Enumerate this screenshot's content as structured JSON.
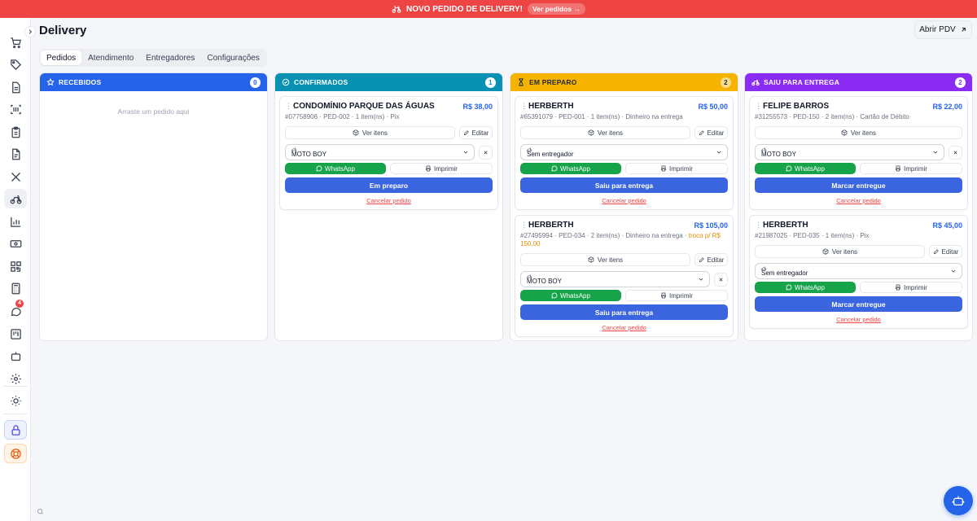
{
  "banner": {
    "text": "NOVO PEDIDO DE DELIVERY!",
    "link": "Ver pedidos →"
  },
  "page": {
    "title": "Delivery",
    "open_pos": "Abrir PDV"
  },
  "tabs": [
    "Pedidos",
    "Atendimento",
    "Entregadores",
    "Configurações"
  ],
  "sidebar": {
    "chat_badge": "4"
  },
  "labels": {
    "ver_itens": "Ver itens",
    "editar": "Editar",
    "whatsapp": "WhatsApp",
    "imprimir": "Imprimir",
    "cancelar": "Cancelar pedido"
  },
  "columns": {
    "recebidos": {
      "title": "RECEBIDOS",
      "count": "0",
      "empty": "Arraste um pedido aqui"
    },
    "confirmados": {
      "title": "CONFIRMADOS",
      "count": "1"
    },
    "em_preparo": {
      "title": "EM PREPARO",
      "count": "2"
    },
    "saiu": {
      "title": "SAIU PARA ENTREGA",
      "count": "2"
    }
  },
  "cards": {
    "c1": {
      "name": "CONDOMÍNIO PARQUE DAS ÁGUAS",
      "price": "R$ 38,00",
      "code": "#07758906",
      "meta": " · PED-002 · 1 item(ns) · Pix",
      "courier": "MOTO BOY",
      "action": "Em preparo"
    },
    "c2": {
      "name": "HERBERTH",
      "price": "R$ 50,00",
      "code": "#65391079",
      "meta": " · PED-001 · 1 item(ns) · Dinheiro na entrega",
      "courier": "Sem entregador",
      "action": "Saiu para entrega"
    },
    "c3": {
      "name": "HERBERTH",
      "price": "R$ 105,00",
      "code": "#27495994",
      "meta": " · PED-034 · 2 item(ns) · Dinheiro na entrega · ",
      "troco": "troco p/ R$ 150,00",
      "courier": "MOTO BOY",
      "action": "Saiu para entrega"
    },
    "c4": {
      "name": "FELIPE BARROS",
      "price": "R$ 22,00",
      "code": "#31255573",
      "meta": " · PED-150 · 2 item(ns) · Cartão de Débito",
      "courier": "MOTO BOY",
      "action": "Marcar entregue"
    },
    "c5": {
      "name": "HERBERTH",
      "price": "R$ 45,00",
      "code": "#21987025",
      "meta": " · PED-035 · 1 item(ns) · Pix",
      "courier": "Sem entregador",
      "action": "Marcar entregue"
    }
  }
}
